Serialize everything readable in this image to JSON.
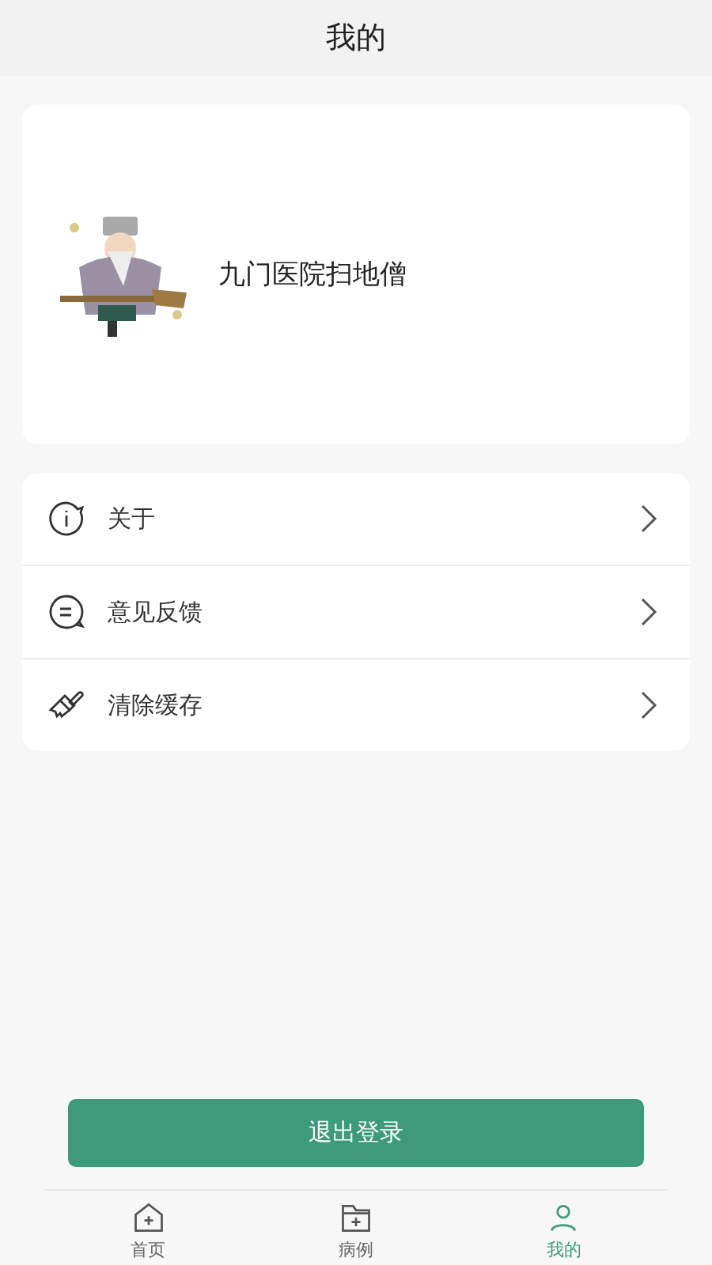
{
  "header": {
    "title": "我的"
  },
  "profile": {
    "name": "九门医院扫地僧"
  },
  "menu": [
    {
      "kind": "info",
      "label": "关于"
    },
    {
      "kind": "feedback",
      "label": "意见反馈"
    },
    {
      "kind": "clear",
      "label": "清除缓存"
    }
  ],
  "logout": {
    "label": "退出登录"
  },
  "nav": [
    {
      "kind": "home",
      "label": "首页",
      "selected": false
    },
    {
      "kind": "cases",
      "label": "病例",
      "selected": false
    },
    {
      "kind": "mine",
      "label": "我的",
      "selected": true
    }
  ]
}
